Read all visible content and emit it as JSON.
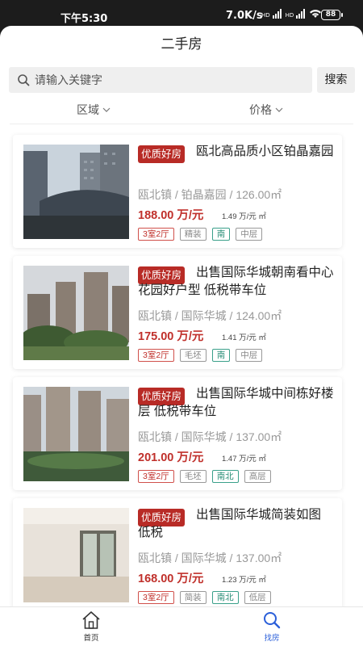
{
  "status_bar": {
    "time": "下午5:30",
    "network_speed": "7.0K/s",
    "battery": "88"
  },
  "header": {
    "title": "二手房"
  },
  "search": {
    "placeholder": "请输入关键字",
    "button_label": "搜索"
  },
  "filters": {
    "region_label": "区域",
    "price_label": "价格"
  },
  "listings": [
    {
      "badge": "优质好房",
      "title": "瓯北高品质小区铂晶嘉园",
      "location": "瓯北镇 / 铂晶嘉园 / 126.00㎡",
      "price": "188.00 万/元",
      "unit_price": "1.49 万/元 ㎡",
      "tags": [
        "3室2厅",
        "精装",
        "南",
        "中层"
      ]
    },
    {
      "badge": "优质好房",
      "title": "出售国际华城朝南看中心花园好户型 低税带车位",
      "location": "瓯北镇 / 国际华城 / 124.00㎡",
      "price": "175.00 万/元",
      "unit_price": "1.41 万/元 ㎡",
      "tags": [
        "3室2厅",
        "毛坯",
        "南",
        "中层"
      ]
    },
    {
      "badge": "优质好房",
      "title": "出售国际华城中间栋好楼层 低税带车位",
      "location": "瓯北镇 / 国际华城 / 137.00㎡",
      "price": "201.00 万/元",
      "unit_price": "1.47 万/元 ㎡",
      "tags": [
        "3室2厅",
        "毛坯",
        "南北",
        "高层"
      ]
    },
    {
      "badge": "优质好房",
      "title": "出售国际华城简装如图 低税",
      "location": "瓯北镇 / 国际华城 / 137.00㎡",
      "price": "168.00 万/元",
      "unit_price": "1.23 万/元 ㎡",
      "tags": [
        "3室2厅",
        "简装",
        "南北",
        "低层"
      ]
    }
  ],
  "tabbar": {
    "home_label": "首页",
    "find_label": "找房",
    "active_color": "#2b5fd9"
  },
  "colors": {
    "accent_red": "#b82b26",
    "tag_green": "#2a8e77"
  }
}
